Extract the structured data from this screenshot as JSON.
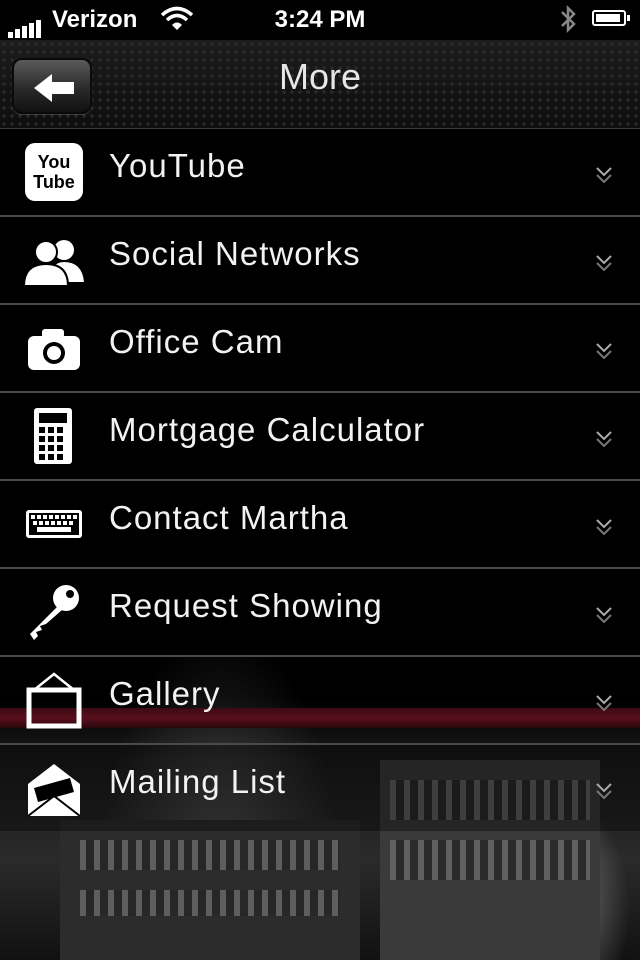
{
  "status_bar": {
    "carrier": "Verizon",
    "time": "3:24 PM",
    "signal_icon": "signal-bars-icon",
    "wifi_icon": "wifi-icon",
    "bluetooth_icon": "bluetooth-icon",
    "battery_icon": "battery-icon"
  },
  "navbar": {
    "title": "More",
    "back_icon": "back-arrow-icon"
  },
  "menu": {
    "items": [
      {
        "label": "YouTube",
        "icon": "youtube-icon",
        "icon_text_1": "You",
        "icon_text_2": "Tube"
      },
      {
        "label": "Social Networks",
        "icon": "people-icon"
      },
      {
        "label": "Office Cam",
        "icon": "camera-icon"
      },
      {
        "label": "Mortgage Calculator",
        "icon": "calculator-icon"
      },
      {
        "label": "Contact Martha",
        "icon": "keyboard-icon"
      },
      {
        "label": "Request Showing",
        "icon": "key-icon"
      },
      {
        "label": "Gallery",
        "icon": "picture-frame-icon"
      },
      {
        "label": "Mailing List",
        "icon": "envelope-icon"
      }
    ],
    "chevron_icon": "chevron-icon"
  },
  "colors": {
    "accent_stripe": "#5a0f1c",
    "row_divider": "#4a4a4a"
  }
}
